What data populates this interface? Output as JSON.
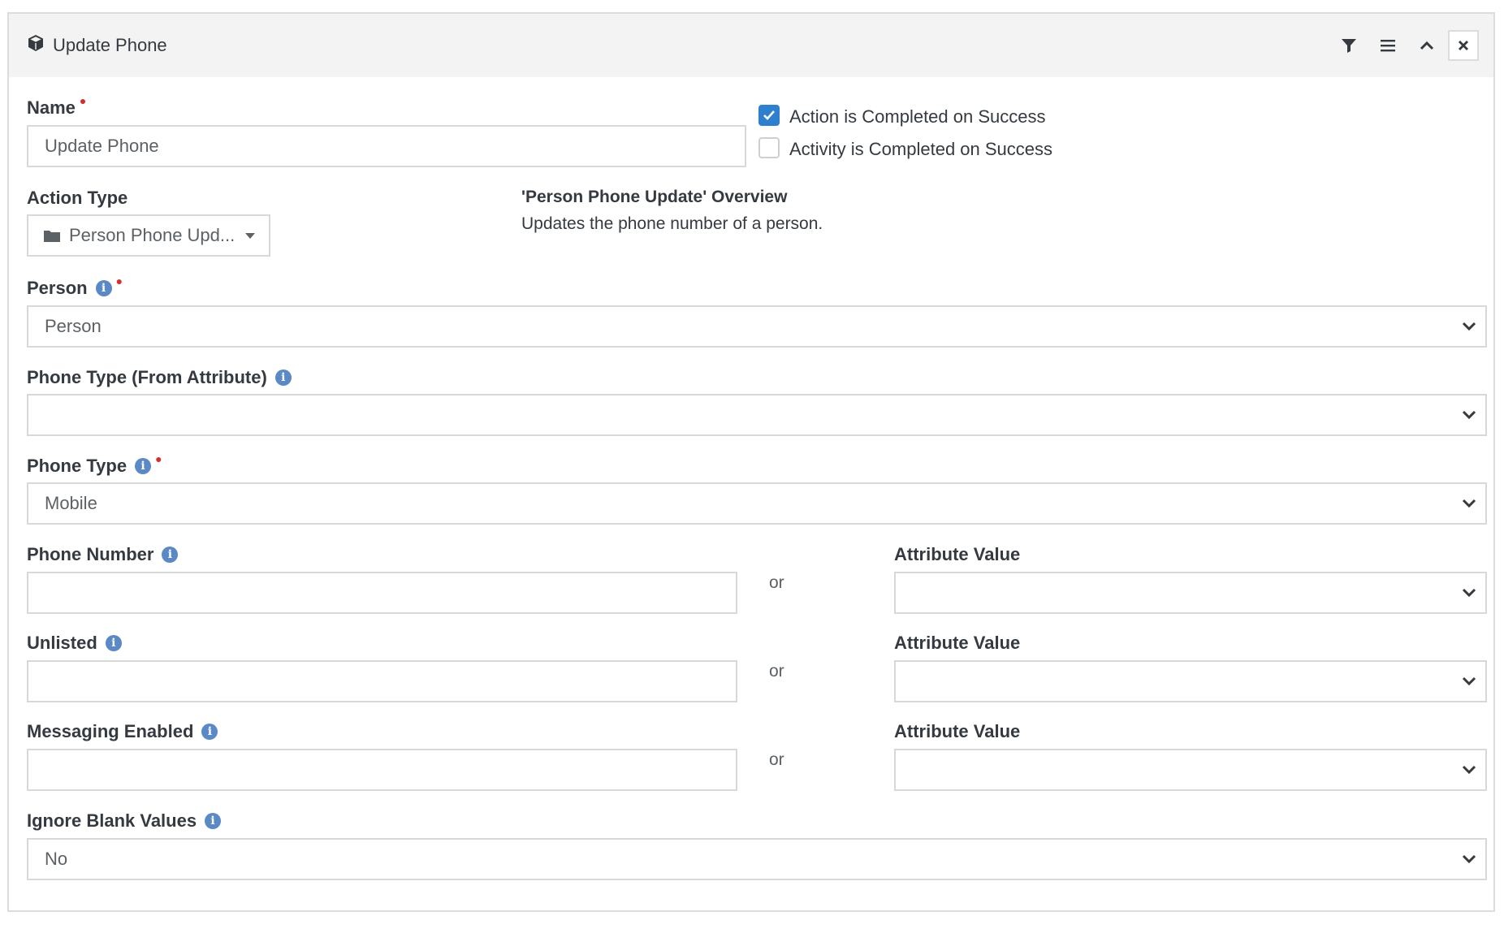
{
  "header": {
    "title": "Update Phone",
    "icon": "cube-icon",
    "actions": [
      "filter-icon",
      "menu-icon",
      "chevron-up-icon",
      "close-icon"
    ]
  },
  "name": {
    "label": "Name",
    "value": "Update Phone"
  },
  "checks": [
    {
      "label": "Action is Completed on Success",
      "checked": true
    },
    {
      "label": "Activity is Completed on Success",
      "checked": false
    }
  ],
  "action_type": {
    "label": "Action Type",
    "value": "Person Phone Upd..."
  },
  "overview": {
    "title": "'Person Phone Update' Overview",
    "text": "Updates the phone number of a person."
  },
  "person": {
    "label": "Person",
    "value": "Person"
  },
  "phone_type_attr": {
    "label": "Phone Type (From Attribute)",
    "value": ""
  },
  "phone_type": {
    "label": "Phone Type",
    "value": "Mobile"
  },
  "phone_number": {
    "label": "Phone Number",
    "value": "",
    "attr_label": "Attribute Value",
    "attr_value": ""
  },
  "unlisted": {
    "label": "Unlisted",
    "value": "",
    "attr_label": "Attribute Value",
    "attr_value": ""
  },
  "messaging": {
    "label": "Messaging Enabled",
    "value": "",
    "attr_label": "Attribute Value",
    "attr_value": ""
  },
  "or_text": "or",
  "ignore_blank": {
    "label": "Ignore Blank Values",
    "value": "No"
  },
  "colors": {
    "accent": "#2f7fcf",
    "required": "#d0312d",
    "info": "#5a89c5",
    "header_bg": "#f3f3f3"
  }
}
